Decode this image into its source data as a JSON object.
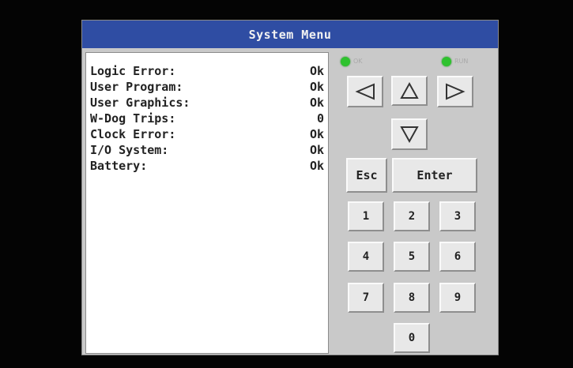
{
  "window": {
    "title": "System Menu"
  },
  "status": {
    "rows": [
      {
        "label": "Logic Error:",
        "value": "Ok"
      },
      {
        "label": "User Program:",
        "value": "Ok"
      },
      {
        "label": "User Graphics:",
        "value": "Ok"
      },
      {
        "label": "W-Dog Trips:",
        "value": "0"
      },
      {
        "label": "Clock Error:",
        "value": "Ok"
      },
      {
        "label": "I/O System:",
        "value": "Ok"
      },
      {
        "label": "Battery:",
        "value": "Ok"
      }
    ]
  },
  "indicators": {
    "ok_label": "OK",
    "run_label": "RUN",
    "color": "#2ec22e"
  },
  "keypad": {
    "left_icon": "left-arrow-icon",
    "up_icon": "up-arrow-icon",
    "down_icon": "down-arrow-icon",
    "right_icon": "right-arrow-icon",
    "esc_label": "Esc",
    "enter_label": "Enter",
    "digits": [
      "1",
      "2",
      "3",
      "4",
      "5",
      "6",
      "7",
      "8",
      "9",
      "0"
    ]
  },
  "colors": {
    "titlebar": "#2f4da3",
    "panel": "#c9c9c9",
    "key": "#e8e8e8"
  }
}
